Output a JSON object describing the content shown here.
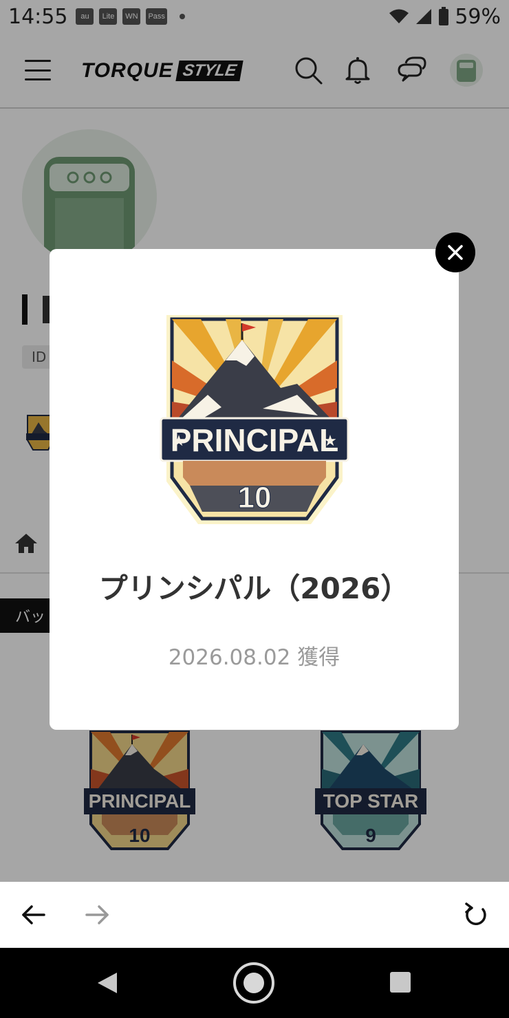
{
  "status_bar": {
    "time": "14:55",
    "notification_icons": [
      "au",
      "Lite",
      "WN",
      "Pass"
    ],
    "battery": "59%"
  },
  "header": {
    "logo_main": "TORQUE",
    "logo_sub": "STYLE"
  },
  "profile": {
    "id_label": "ID",
    "badge_tab_label": "バッ"
  },
  "modal": {
    "badge_name": "PRINCIPAL",
    "badge_level": "10",
    "title": "プリンシパル（2026）",
    "date": "2026.08.02 獲得"
  },
  "grid_badges": [
    {
      "name": "PRINCIPAL",
      "level": "10",
      "theme": "sunset"
    },
    {
      "name": "TOP STAR",
      "level": "9",
      "theme": "teal"
    }
  ],
  "colors": {
    "overlay": "#000000",
    "badge_navy": "#1f2a44",
    "badge_orange": "#e07a2e",
    "badge_teal": "#2f7a86"
  }
}
